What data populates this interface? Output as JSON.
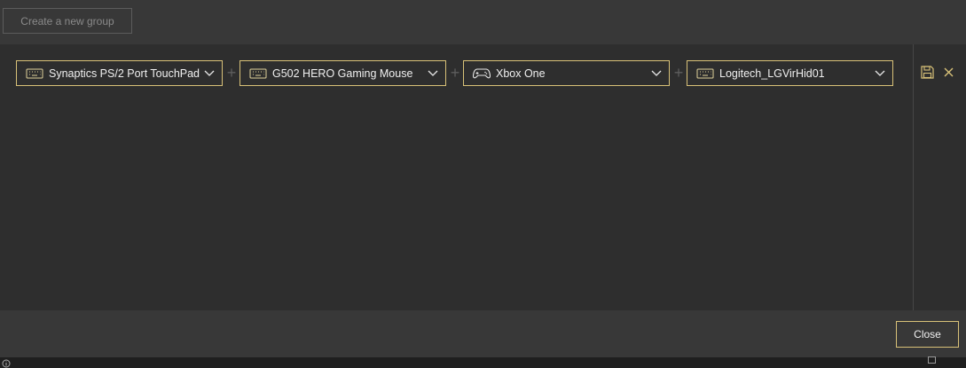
{
  "header": {
    "create_group_label": "Create a new group"
  },
  "group": {
    "devices": [
      {
        "label": "Synaptics PS/2 Port TouchPad",
        "icon": "keyboard-icon"
      },
      {
        "label": "G502 HERO Gaming Mouse",
        "icon": "keyboard-icon"
      },
      {
        "label": "Xbox One",
        "icon": "gamepad-icon"
      },
      {
        "label": "Logitech_LGVirHid01",
        "icon": "keyboard-icon"
      }
    ],
    "separator": "+"
  },
  "footer": {
    "close_label": "Close"
  },
  "colors": {
    "accent": "#d8c178",
    "background": "#2e2e2e",
    "panel": "#383838"
  }
}
